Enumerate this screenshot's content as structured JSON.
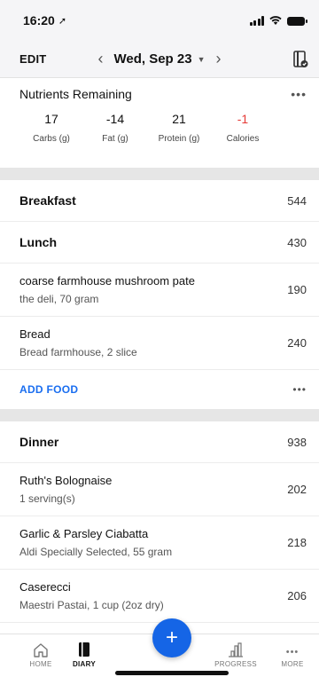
{
  "status": {
    "time": "16:20"
  },
  "nav": {
    "edit": "EDIT",
    "date": "Wed, Sep 23"
  },
  "nutrients": {
    "title": "Nutrients Remaining",
    "more": "•••",
    "items": [
      {
        "value": "17",
        "label": "Carbs (g)"
      },
      {
        "value": "-14",
        "label": "Fat (g)"
      },
      {
        "value": "21",
        "label": "Protein (g)"
      },
      {
        "value": "-1",
        "label": "Calories"
      }
    ]
  },
  "breakfast": {
    "name": "Breakfast",
    "kcal": "544"
  },
  "lunch": {
    "name": "Lunch",
    "kcal": "430",
    "foods": [
      {
        "title": "coarse farmhouse mushroom pate",
        "sub": "the deli, 70 gram",
        "kcal": "190"
      },
      {
        "title": "Bread",
        "sub": "Bread farmhouse, 2 slice",
        "kcal": "240"
      }
    ],
    "add": "ADD FOOD",
    "more": "•••"
  },
  "dinner": {
    "name": "Dinner",
    "kcal": "938",
    "foods": [
      {
        "title": "Ruth's Bolognaise",
        "sub": "1 serving(s)",
        "kcal": "202"
      },
      {
        "title": "Garlic & Parsley Ciabatta",
        "sub": "Aldi Specially Selected, 55 gram",
        "kcal": "218"
      },
      {
        "title": "Caserecci",
        "sub": "Maestri Pastai, 1 cup (2oz dry)",
        "kcal": "206"
      }
    ]
  },
  "tabs": {
    "home": "HOME",
    "diary": "DIARY",
    "add": "+",
    "progress": "PROGRESS",
    "more": "MORE",
    "more_icon": "•••"
  },
  "colors": {
    "accent": "#1565e6",
    "negative": "#e53935"
  }
}
